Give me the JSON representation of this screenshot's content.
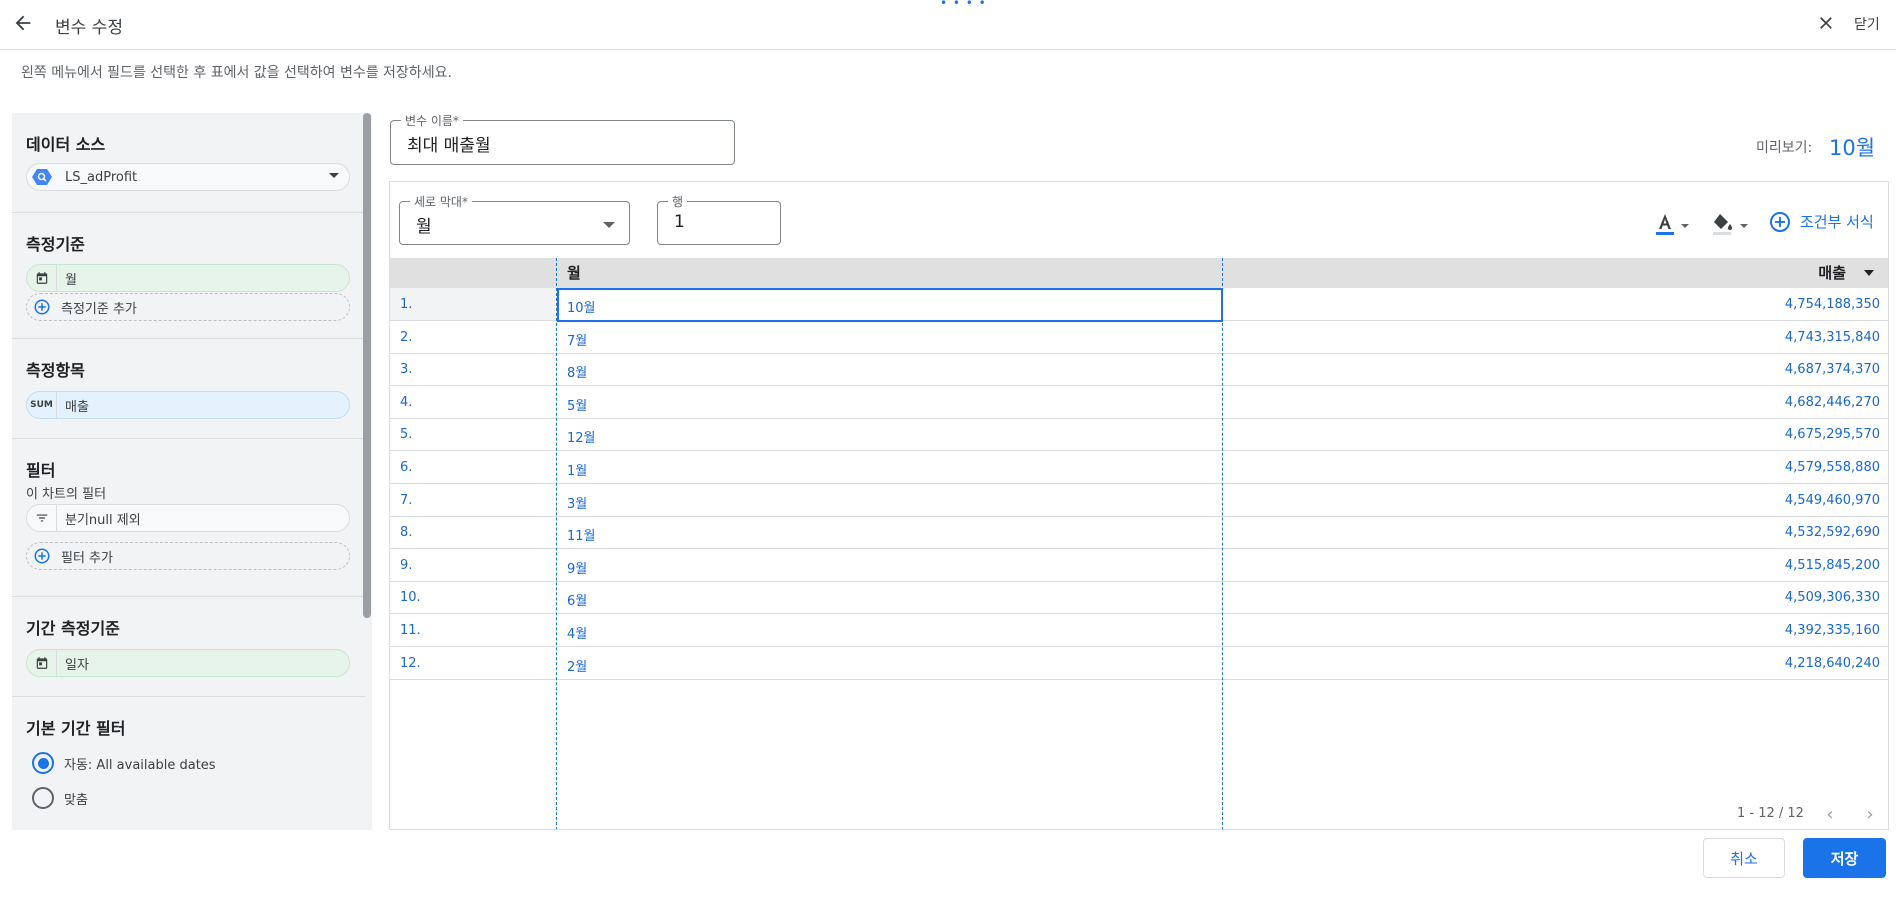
{
  "header": {
    "title": "변수 수정",
    "close_label": "닫기"
  },
  "instruction": "왼쪽 메뉴에서 필드를 선택한 후 표에서 값을 선택하여 변수를 저장하세요.",
  "sidebar": {
    "data_source": {
      "title": "데이터 소스",
      "value": "LS_adProfit"
    },
    "dimension": {
      "title": "측정기준",
      "chip": "월",
      "add_label": "측정기준 추가"
    },
    "metric": {
      "title": "측정항목",
      "agg": "SUM",
      "chip": "매출"
    },
    "filter": {
      "title": "필터",
      "sub_label": "이 차트의 필터",
      "chip": "분기null 제외",
      "add_label": "필터 추가"
    },
    "date_dimension": {
      "title": "기간 측정기준",
      "chip": "일자"
    },
    "date_filter": {
      "title": "기본 기간 필터",
      "options": [
        {
          "label": "자동: All available dates",
          "checked": true
        },
        {
          "label": "맞춤",
          "checked": false
        }
      ]
    }
  },
  "variable_name": {
    "label": "변수 이름*",
    "value": "최대 매출월"
  },
  "preview": {
    "label": "미리보기:",
    "value": "10월"
  },
  "column_field": {
    "label": "세로 막대*",
    "value": "월"
  },
  "row_field": {
    "label": "행",
    "value": "1"
  },
  "toolbar": {
    "text_color_icon": "text-color-icon",
    "fill_color_icon": "fill-color-icon",
    "conditional_format_label": "조건부 서식"
  },
  "table": {
    "headers": {
      "month": "월",
      "sales": "매출"
    },
    "rows": [
      {
        "idx": "1.",
        "month": "10월",
        "sales": "4,754,188,350"
      },
      {
        "idx": "2.",
        "month": "7월",
        "sales": "4,743,315,840"
      },
      {
        "idx": "3.",
        "month": "8월",
        "sales": "4,687,374,370"
      },
      {
        "idx": "4.",
        "month": "5월",
        "sales": "4,682,446,270"
      },
      {
        "idx": "5.",
        "month": "12월",
        "sales": "4,675,295,570"
      },
      {
        "idx": "6.",
        "month": "1월",
        "sales": "4,579,558,880"
      },
      {
        "idx": "7.",
        "month": "3월",
        "sales": "4,549,460,970"
      },
      {
        "idx": "8.",
        "month": "11월",
        "sales": "4,532,592,690"
      },
      {
        "idx": "9.",
        "month": "9월",
        "sales": "4,515,845,200"
      },
      {
        "idx": "10.",
        "month": "6월",
        "sales": "4,509,306,330"
      },
      {
        "idx": "11.",
        "month": "4월",
        "sales": "4,392,335,160"
      },
      {
        "idx": "12.",
        "month": "2월",
        "sales": "4,218,640,240"
      }
    ],
    "pagination": "1 - 12 / 12"
  },
  "footer": {
    "cancel_label": "취소",
    "save_label": "저장"
  },
  "colors": {
    "accent": "#1a73e8",
    "link": "#1967d2",
    "dimension_chip": "#e6f4ea",
    "metric_chip": "#e3f2fd"
  }
}
